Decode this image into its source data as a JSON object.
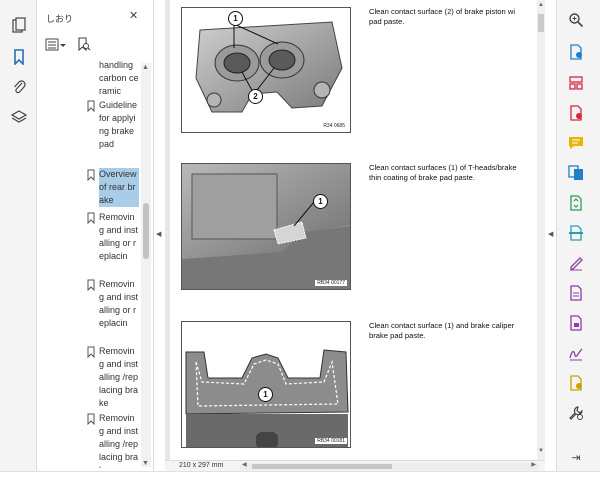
{
  "colors": {
    "accent_blue": "#2a6fb8",
    "selection": "#a9cde8",
    "fill_sign_purple": "#8a3fa6",
    "export_red": "#d7263d",
    "comment_yellow": "#e8b400",
    "organize_green": "#2f9d4e",
    "protect_blue": "#1f7fc9",
    "send_yellow": "#c9a200"
  },
  "left_rail": {
    "icons": [
      "page-thumbnails-icon",
      "bookmark-icon",
      "attachment-icon",
      "layers-icon"
    ]
  },
  "bookmarks_panel": {
    "title": "しおり",
    "close_glyph": "✕",
    "items": [
      {
        "label": "handling carbon ceramic",
        "selected": false
      },
      {
        "label": "Guideline for applying brake pad",
        "selected": false
      },
      {
        "label": "Overview of rear brake",
        "selected": true
      },
      {
        "label": "Removing and installing or replacin",
        "selected": false
      },
      {
        "label": "Removing and installing or replacin",
        "selected": false
      },
      {
        "label": "Removing and installing /replacing brake",
        "selected": false
      },
      {
        "label": "Removing and installing /replacing brake",
        "selected": false
      }
    ]
  },
  "document": {
    "figures": [
      {
        "code": "R34 0685",
        "callouts": [
          "1",
          "2"
        ]
      },
      {
        "code": "RB34 00177",
        "callouts": [
          "1"
        ]
      },
      {
        "code": "RB34 00181",
        "callouts": [
          "1"
        ]
      }
    ],
    "instructions": [
      "Clean contact surface (2) of brake piston wi\npad paste.",
      "Clean contact surfaces (1) of T-heads/brake\nthin coating of brake pad paste.",
      "Clean contact surface (1) and brake caliper\nbrake pad paste."
    ],
    "page_size": "210 x 297 mm"
  },
  "right_rail": {
    "tools": [
      {
        "name": "zoom-tool",
        "icon": "zoom-icon",
        "color": "#444444"
      },
      {
        "name": "create-pdf-tool",
        "icon": "create-pdf-icon",
        "color": "#1f7fc9"
      },
      {
        "name": "organize-pages-tool",
        "icon": "organize-pages-icon",
        "color": "#d7263d"
      },
      {
        "name": "export-pdf-tool",
        "icon": "export-pdf-icon",
        "color": "#d7263d"
      },
      {
        "name": "comment-tool",
        "icon": "comment-icon",
        "color": "#e8b400"
      },
      {
        "name": "combine-files-tool",
        "icon": "combine-files-icon",
        "color": "#1f7fc9"
      },
      {
        "name": "compress-tool",
        "icon": "compress-icon",
        "color": "#2f9d4e"
      },
      {
        "name": "scan-ocr-tool",
        "icon": "scan-ocr-icon",
        "color": "#2a9db8"
      },
      {
        "name": "fill-sign-tool",
        "icon": "fill-sign-icon",
        "color": "#8a3fa6"
      },
      {
        "name": "edit-pdf-tool",
        "icon": "edit-pdf-icon",
        "color": "#8a3fa6"
      },
      {
        "name": "protect-tool",
        "icon": "protect-icon",
        "color": "#8a3fa6"
      },
      {
        "name": "request-signature-tool",
        "icon": "request-signature-icon",
        "color": "#8a3fa6"
      },
      {
        "name": "send-track-tool",
        "icon": "send-track-icon",
        "color": "#c9a200"
      },
      {
        "name": "more-tools",
        "icon": "wrench-icon",
        "color": "#444444"
      }
    ],
    "collapse_glyph": "⇥"
  }
}
